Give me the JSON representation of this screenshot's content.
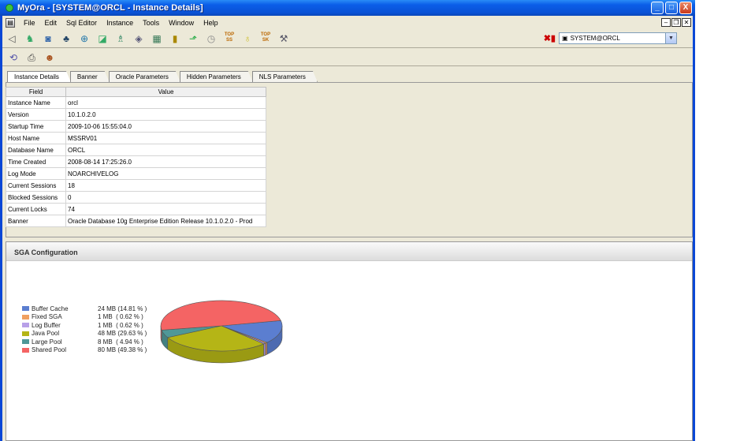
{
  "window": {
    "title": "MyOra - [SYSTEM@ORCL - Instance Details]",
    "controls": [
      "_",
      "□",
      "X"
    ]
  },
  "menu": [
    "File",
    "Edit",
    "Sql Editor",
    "Instance",
    "Tools",
    "Window",
    "Help"
  ],
  "toolbar": {
    "icons": [
      "sql-editor-icon",
      "sessions-icon",
      "database-icon",
      "users-icon",
      "network-icon",
      "tablespace-icon",
      "objects-icon",
      "tag-icon",
      "report-icon",
      "statistics-icon",
      "chart-icon",
      "history-icon",
      "top-ss-icon",
      "bulb-icon",
      "top-sk-icon",
      "tools-icon"
    ],
    "top_ss": "TOP\nSS",
    "top_sk": "TOP\nSK"
  },
  "connection": {
    "value": "SYSTEM@ORCL"
  },
  "toolbar2_icons": [
    "refresh-icon",
    "print-icon",
    "help-icon"
  ],
  "tabs": [
    "Instance Details",
    "Banner",
    "Oracle Parameters",
    "Hidden Parameters",
    "NLS Parameters"
  ],
  "table": {
    "headers": [
      "Field",
      "Value"
    ],
    "rows": [
      [
        "Instance Name",
        "orcl"
      ],
      [
        "Version",
        "10.1.0.2.0"
      ],
      [
        "Startup Time",
        "2009-10-06 15:55:04.0"
      ],
      [
        "Host Name",
        "MSSRV01"
      ],
      [
        "Database Name",
        "ORCL"
      ],
      [
        "Time Created",
        "2008-08-14 17:25:26.0"
      ],
      [
        "Log Mode",
        "NOARCHIVELOG"
      ],
      [
        "Current Sessions",
        "18"
      ],
      [
        "Blocked Sessions",
        "0"
      ],
      [
        "Current Locks",
        "74"
      ],
      [
        "Banner",
        "Oracle Database 10g Enterprise Edition Release 10.1.0.2.0 - Prod"
      ]
    ]
  },
  "sga": {
    "title": "SGA Configuration",
    "chart_data": {
      "type": "pie",
      "slices": [
        {
          "name": "Buffer Cache",
          "label": "24 MB (14.81 % )",
          "value": 14.81,
          "color": "#5b7ed0"
        },
        {
          "name": "Fixed SGA",
          "label": "1 MB  ( 0.62 % )",
          "value": 0.62,
          "color": "#f0a060"
        },
        {
          "name": "Log Buffer",
          "label": "1 MB  ( 0.62 % )",
          "value": 0.62,
          "color": "#b8a0e8"
        },
        {
          "name": "Java Pool",
          "label": "48 MB (29.63 % )",
          "value": 29.63,
          "color": "#b5b516"
        },
        {
          "name": "Large Pool",
          "label": "8 MB  ( 4.94 % )",
          "value": 4.94,
          "color": "#4f9898"
        },
        {
          "name": "Shared Pool",
          "label": "80 MB (49.38 % )",
          "value": 49.38,
          "color": "#f46464"
        }
      ]
    }
  }
}
